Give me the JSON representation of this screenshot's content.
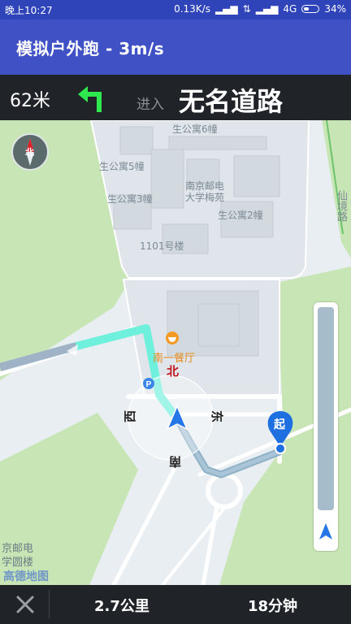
{
  "status_bar": {
    "time": "晚上10:27",
    "network_speed": "0.13K/s",
    "network_type": "4G",
    "battery": "34%"
  },
  "app_bar": {
    "title": "模拟户外跑 - 3m/s"
  },
  "nav_panel": {
    "distance": "62米",
    "turn_icon": "turn-left-arrow",
    "enter_label": "进入",
    "road_name": "无名道路"
  },
  "map": {
    "compass_label": "北",
    "labels": {
      "apt6": "生公寓6幢",
      "apt5": "生公寓5幢",
      "school1": "南京邮电",
      "school2": "大学梅苑",
      "apt3": "生公寓3幢",
      "apt2": "生公寓2幢",
      "bldg1101": "1101号楼",
      "road_right": "仙境路",
      "canteen": "南一餐厅",
      "campus1": "京邮电",
      "campus2": "学圆楼",
      "logo": "高德地图"
    },
    "direction_labels": {
      "north": "北",
      "south": "南",
      "east": "东",
      "west": "西"
    },
    "start_marker": "起"
  },
  "bottom_bar": {
    "distance": "2.7公里",
    "time": "18分钟"
  },
  "colors": {
    "status_bar": "#2f44b8",
    "app_bar": "#3f51c5",
    "nav_panel": "#202428",
    "turn_arrow": "#2ee84d",
    "route_active": "#6ef0dc",
    "route_passed": "#8fb1c8",
    "start_marker": "#1e6fe0",
    "green_area": "#c8e6b5"
  }
}
